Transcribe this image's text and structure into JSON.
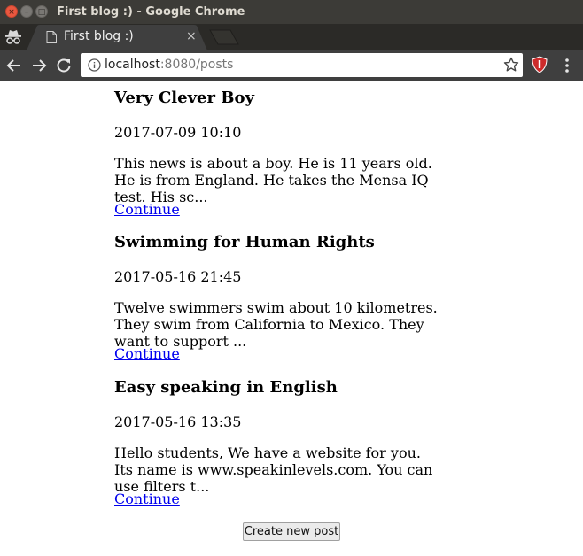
{
  "window": {
    "title": "First blog :) - Google Chrome",
    "close_glyph": "×",
    "min_glyph": "–",
    "max_glyph": "□"
  },
  "tabs": [
    {
      "title": "First blog :)",
      "close_glyph": "×",
      "active": true
    }
  ],
  "address_bar": {
    "host": "localhost",
    "port_path": ":8080/posts"
  },
  "icons": {
    "incognito": "incognito-icon",
    "page": "page-icon",
    "back": "back-arrow-icon",
    "forward": "forward-arrow-icon",
    "reload": "reload-icon",
    "info": "info-icon",
    "star": "star-icon",
    "extension": "ublock-icon",
    "menu": "kebab-menu-icon"
  },
  "colors": {
    "titlebar": "#3c3b37",
    "tabstrip": "#2b2a27",
    "active_tab": "#3f3f3f",
    "toolbar": "#3f3f3f",
    "link": "#0000ee",
    "close_button": "#e9573f",
    "extension_badge": "#cc2b2b"
  },
  "posts": [
    {
      "title": "Very Clever Boy",
      "date": "2017-07-09 10:10",
      "excerpt": "This news is about a boy. He is 11 years old. He is from England. He takes the Mensa IQ test. His sc...",
      "link": "Continue"
    },
    {
      "title": "Swimming for Human Rights",
      "date": "2017-05-16 21:45",
      "excerpt": "Twelve swimmers swim about 10 kilometres. They swim from California to Mexico. They want to support ...",
      "link": "Continue"
    },
    {
      "title": "Easy speaking in English",
      "date": "2017-05-16 13:35",
      "excerpt": "Hello students, We have a website for you. Its name is www.speakinlevels.com. You can use filters t...",
      "link": "Continue"
    }
  ],
  "create_button": "Create new post"
}
